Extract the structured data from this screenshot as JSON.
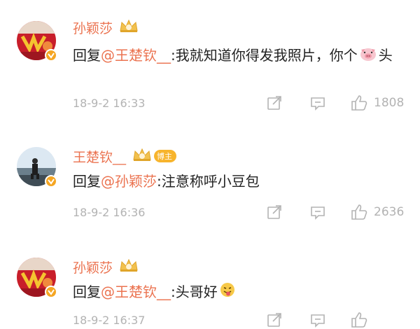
{
  "comments": [
    {
      "username": "孙颖莎",
      "reply_prefix": "回复",
      "mention": "@王楚钦__",
      "text_part1": ":我就知道你得发我照片，你个",
      "emoji": "pig-face",
      "text_part2": "头",
      "time": "18-9-2 16:33",
      "likes": "1808",
      "host": false
    },
    {
      "username": "王楚钦__",
      "host_badge": "博主",
      "reply_prefix": "回复",
      "mention": "@孙颖莎",
      "text_part1": ":注意称呼小豆包",
      "time": "18-9-2 16:36",
      "likes": "2636",
      "host": true
    },
    {
      "username": "孙颖莎",
      "reply_prefix": "回复",
      "mention": "@王楚钦__",
      "text_part1": ":头哥好",
      "emoji": "tongue-out-face",
      "time": "18-9-2 16:37",
      "likes": "",
      "host": false
    }
  ],
  "colors": {
    "name": "#eb7350",
    "text": "#222222",
    "meta": "#b3b3b3",
    "verified": "#f5a623"
  }
}
